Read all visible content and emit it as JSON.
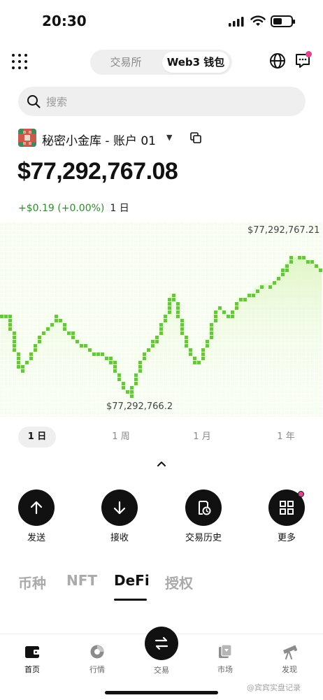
{
  "status_bar": {
    "time": "20:30"
  },
  "header": {
    "segments": [
      {
        "label": "交易所",
        "active": false
      },
      {
        "label": "Web3 钱包",
        "active": true
      }
    ],
    "notification_dot_color": "#e0448a"
  },
  "search": {
    "placeholder": "搜索"
  },
  "account": {
    "name": "秘密小金库 - 账户 01",
    "caret": "▼"
  },
  "balance": {
    "amount": "$77,292,767.08",
    "change": "+$0.19 (+0.00%)",
    "period": "1 日"
  },
  "chart_data": {
    "type": "line",
    "max_label": "$77,292,767.21",
    "min_label": "$77,292,766.2",
    "y": [
      0.55,
      0.53,
      0.34,
      0.19,
      0.25,
      0.33,
      0.38,
      0.44,
      0.48,
      0.53,
      0.48,
      0.44,
      0.38,
      0.35,
      0.35,
      0.3,
      0.3,
      0.27,
      0.25,
      0.15,
      0.07,
      0.02,
      0.13,
      0.23,
      0.31,
      0.36,
      0.42,
      0.55,
      0.68,
      0.56,
      0.39,
      0.3,
      0.24,
      0.26,
      0.38,
      0.55,
      0.59,
      0.54,
      0.53,
      0.64,
      0.65,
      0.66,
      0.71,
      0.74,
      0.74,
      0.75,
      0.8,
      0.87,
      0.91,
      0.91,
      0.91,
      0.88,
      0.86,
      0.84
    ],
    "line_color": "#6fc04a",
    "fill_color": "#e8f8d4"
  },
  "ranges": [
    "1 日",
    "1 周",
    "1 月",
    "1 年"
  ],
  "actions": [
    "发送",
    "接收",
    "交易历史",
    "更多"
  ],
  "tabs": [
    "币种",
    "NFT",
    "DeFi",
    "授权"
  ],
  "active_tab": "DeFi",
  "bottom_nav": {
    "home": "首页",
    "market": "行情",
    "trade": "交易",
    "marketplace": "市场",
    "explore": "发现"
  },
  "watermark": "@宾宾实盘记录"
}
